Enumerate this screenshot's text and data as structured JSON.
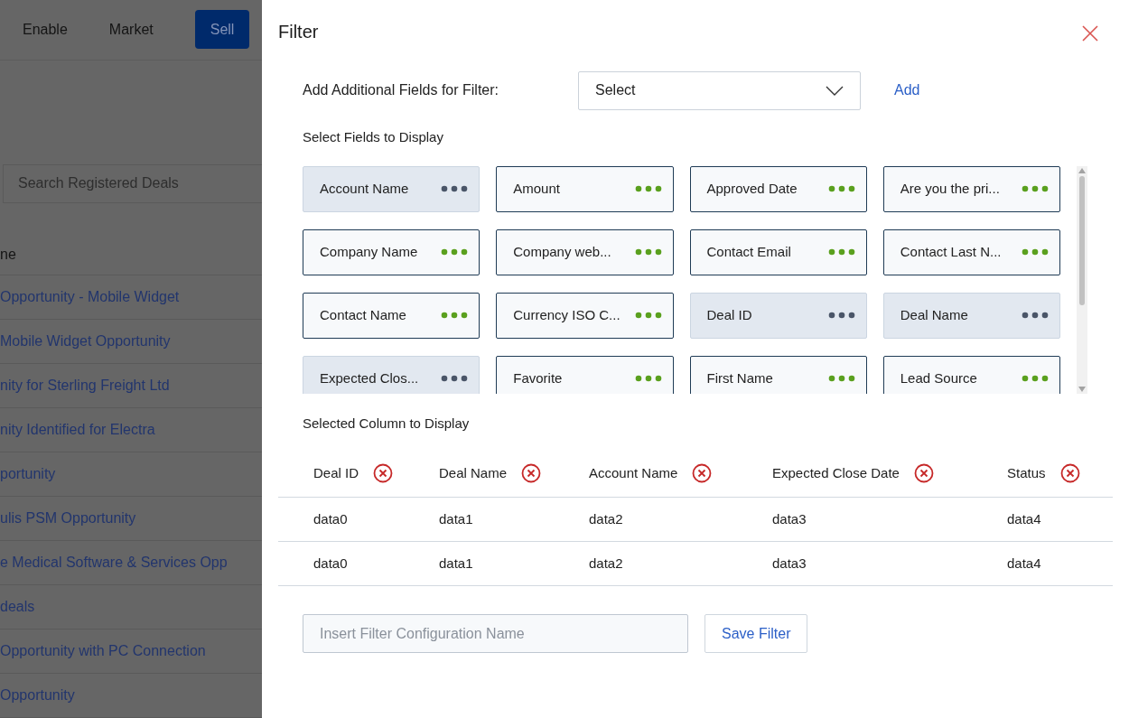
{
  "background_page": {
    "nav": [
      {
        "label": "Enable",
        "selected": false
      },
      {
        "label": "Market",
        "selected": false
      },
      {
        "label": "Sell",
        "selected": true
      }
    ],
    "search": {
      "placeholder": "Search Registered Deals"
    },
    "table": {
      "column_1": "ne",
      "rows": [
        "Opportunity - Mobile Widget",
        "Mobile Widget Opportunity",
        "nity for Sterling Freight Ltd",
        "nity Identified for Electra",
        "portunity",
        "ulis PSM Opportunity",
        "e Medical Software & Services Opp",
        "deals",
        "Opportunity with PC Connection",
        "Opportunity"
      ]
    }
  },
  "filter_panel": {
    "title": "Filter",
    "add_field": {
      "label": "Add Additional Fields for Filter:",
      "select": "Select",
      "add_button": "Add"
    },
    "fields_heading": "Select Fields to Display",
    "fields": [
      {
        "label": "Account Name",
        "selected": true
      },
      {
        "label": "Amount",
        "selected": false
      },
      {
        "label": "Approved Date",
        "selected": false
      },
      {
        "label": "Are you the pri...",
        "selected": false
      },
      {
        "label": "Company Name",
        "selected": false
      },
      {
        "label": "Company web...",
        "selected": false
      },
      {
        "label": "Contact Email",
        "selected": false
      },
      {
        "label": "Contact Last N...",
        "selected": false
      },
      {
        "label": "Contact Name",
        "selected": false
      },
      {
        "label": "Currency ISO C...",
        "selected": false
      },
      {
        "label": "Deal ID",
        "selected": true
      },
      {
        "label": "Deal Name",
        "selected": true
      },
      {
        "label": "Expected Clos...",
        "selected": true
      },
      {
        "label": "Favorite",
        "selected": false
      },
      {
        "label": "First Name",
        "selected": false
      },
      {
        "label": "Lead Source",
        "selected": false
      }
    ],
    "columns_heading": "Selected Column to Display",
    "table": {
      "columns": [
        "Deal ID",
        "Deal Name",
        "Account Name",
        "Expected Close Date",
        "Status"
      ],
      "rows": [
        [
          "data0",
          "data1",
          "data2",
          "data3",
          "data4"
        ],
        [
          "data0",
          "data1",
          "data2",
          "data3",
          "data4"
        ]
      ]
    },
    "name_field": {
      "placeholder": "Insert Filter Configuration Name"
    },
    "save_button": "Save Filter"
  }
}
